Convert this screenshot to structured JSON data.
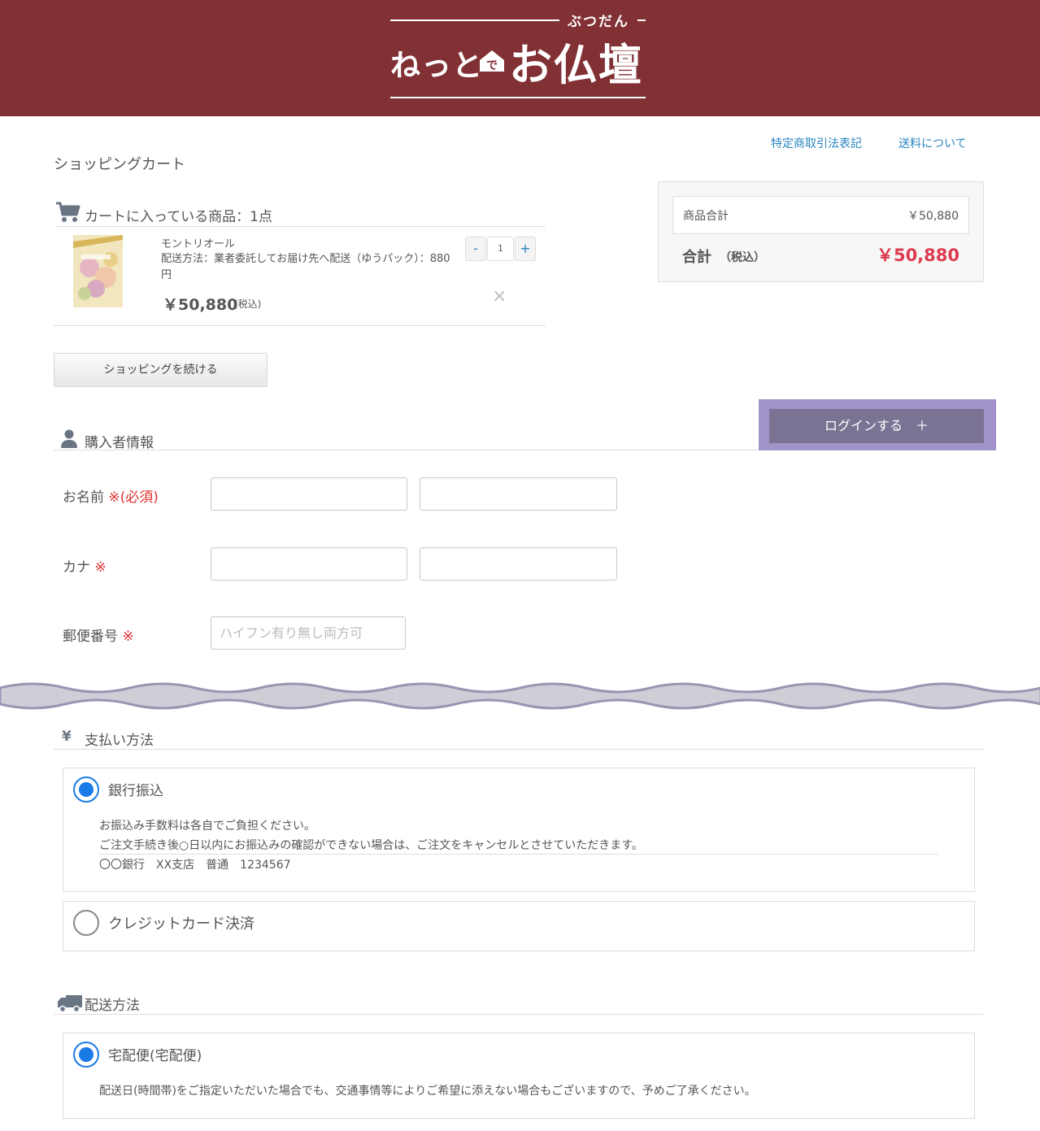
{
  "header": {
    "logo_furigana": "ぶつだん",
    "logo_text_a": "ねっと",
    "logo_house_char": "で",
    "logo_text_b": "お仏壇",
    "bg_color": "#813034"
  },
  "top_links": {
    "commercial_law": "特定商取引法表記",
    "shipping": "送料について"
  },
  "page_title": "ショッピングカート",
  "cart": {
    "heading": "カートに入っている商品：1点",
    "item": {
      "name": "モントリオール",
      "shipping_method": "配送方法：業者委託してお届け先へ配送（ゆうパック）：880円",
      "price": "￥50,880",
      "tax_note": "(税込)",
      "quantity": "1",
      "minus": "-",
      "plus": "+",
      "remove": "×"
    },
    "continue_button": "ショッピングを続ける"
  },
  "summary": {
    "subtotal_label": "商品合計",
    "subtotal_value": "￥50,880",
    "total_label": "合計",
    "total_tax": "（税込）",
    "total_value": "￥50,880",
    "total_color": "#de3a4f"
  },
  "login": {
    "label": "ログインする　＋"
  },
  "buyer": {
    "heading": "購入者情報",
    "name_label": "お名前",
    "name_required": "※(必須)",
    "kana_label": "カナ",
    "kana_required": "※",
    "zip_label": "郵便番号",
    "zip_required": "※",
    "zip_placeholder": "ハイフン有り無し両方可"
  },
  "payment": {
    "heading_icon": "¥",
    "heading": "支払い方法",
    "options": [
      {
        "label": "銀行振込",
        "selected": true,
        "note_1": "お振込み手数料は各自でご負担ください。",
        "note_2": "ご注文手続き後○日以内にお振込みの確認ができない場合は、ご注文をキャンセルとさせていただきます。",
        "note_3": "〇〇銀行　XX支店　普通　1234567"
      },
      {
        "label": "クレジットカード決済",
        "selected": false
      }
    ]
  },
  "delivery": {
    "heading": "配送方法",
    "options": [
      {
        "label": "宅配便(宅配便)",
        "selected": true,
        "note": "配送日(時間帯)をご指定いただいた場合でも、交通事情等によりご希望に添えない場合もございますので、予めご了承ください。"
      }
    ]
  }
}
